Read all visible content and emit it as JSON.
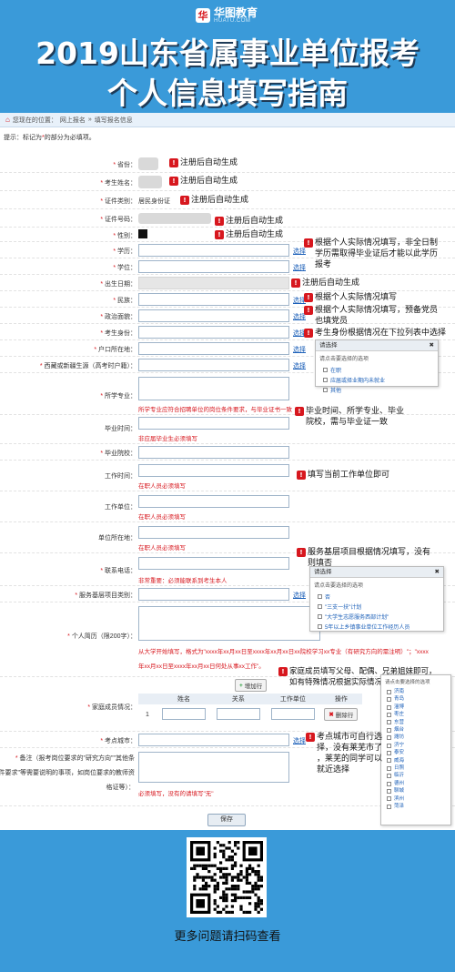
{
  "header": {
    "logo_text": "华图教育",
    "logo_sub": "HUATU.COM",
    "title_line1": "2019山东省属事业单位报考",
    "title_line2": "个人信息填写指南"
  },
  "breadcrumb": {
    "prefix": "您现在的位置：",
    "item1": "网上报名",
    "item2": "填写报名信息"
  },
  "note": {
    "text": "提示：标记为",
    "star": "*",
    "text2": "的部分为必填项。"
  },
  "fields": {
    "province": "省份：",
    "name": "考生姓名：",
    "id_type": "证件类别：",
    "id_type_value": "居民身份证",
    "id_no": "证件号码：",
    "gender": "性别：",
    "edu": "学历：",
    "degree": "学位：",
    "birth": "出生日期：",
    "ethnic": "民族：",
    "politics": "政治面貌：",
    "identity": "考生身份：",
    "hukou": "户口所在地：",
    "origin": "西藏或新疆生源（高考时户籍）：",
    "major": "所学专业：",
    "grad_time": "毕业时间：",
    "school": "毕业院校：",
    "work_time": "工作时间：",
    "employer": "工作单位：",
    "employer_loc": "单位所在地：",
    "phone": "联系电话：",
    "grassroots": "服务基层项目类别：",
    "resume": "个人简历（限200字）：",
    "family": "家庭成员情况：",
    "exam_city": "考点城市：",
    "remark_l1": "备注（报考岗位要求的\"研究方向\"\"其他条",
    "remark_l2": "件要求\"等需要说明的事项，如岗位要求的教师资",
    "remark_l3": "格证等）："
  },
  "links": {
    "select": "选择"
  },
  "hints": {
    "major": "所学专业应符合招聘单位的岗位条件要求，与毕业证书一致",
    "grad": "非应届毕业生必须填写",
    "work_time": "在职人员必须填写",
    "employer": "在职人员必须填写",
    "employer_loc": "在职人员必须填写",
    "phone": "非常重要：必须能联系到考生本人",
    "resume_l1": "从大学开始填写，格式为\"xxxx年xx月xx日至xxxx年xx月xx日xx院校学习xx专业（有研究方向的需注明）\"；\"xxxx",
    "resume_l2": "年xx月xx日至xxxx年xx月xx日何处从事xx工作\"。",
    "remark": "必须填写，没有的请填写\"无\""
  },
  "annotations": {
    "a1": "注册后自动生成",
    "a2": "注册后自动生成",
    "a3": "注册后自动生成",
    "a4": "注册后自动生成",
    "a5": "注册后自动生成",
    "a_edu_l1": "根据个人实际情况填写，非全日制",
    "a_edu_l2": "学历需取得毕业证后才能以此学历",
    "a_edu_l3": "报考",
    "a_birth": "注册后自动生成",
    "a_ethnic": "根据个人实际情况填写",
    "a_pol_l1": "根据个人实际情况填写，预备党员",
    "a_pol_l2": "也填党员",
    "a_identity": "考生身份根据情况在下拉列表中选择",
    "a_grad_l1": "毕业时间、所学专业、毕业",
    "a_grad_l2": "院校，需与毕业证一致",
    "a_work": "填写当前工作单位即可",
    "a_grass_l1": "服务基层项目根据情况填写，没有",
    "a_grass_l2": "则填否",
    "a_fam_l1": "家庭成员填写父母、配偶、兄弟姐妹即可，",
    "a_fam_l2": "如有特殊情况根据实际情况填写",
    "a_city_l1": "考点城市可自行选",
    "a_city_l2": "择，没有莱芜市了",
    "a_city_l3": "，莱芜的同学可以",
    "a_city_l4": "就近选择"
  },
  "popup_identity": {
    "title": "请选择",
    "prompt": "请点击要选择的选项",
    "options": [
      "在职",
      "应届或择业期内未就业",
      "其他"
    ]
  },
  "popup_grassroots": {
    "title": "请选择",
    "prompt": "请点击要选择的选项",
    "options": [
      "否",
      "\"三支一扶\"计划",
      "\"大学生志愿服务西部计划\"",
      "5年以上乡镇事业单位工作经历人员"
    ]
  },
  "popup_city": {
    "prompt": "请点击要选择的选项",
    "options": [
      "济南",
      "青岛",
      "淄博",
      "枣庄",
      "东营",
      "烟台",
      "潍坊",
      "济宁",
      "泰安",
      "威海",
      "日照",
      "临沂",
      "德州",
      "聊城",
      "滨州",
      "菏泽"
    ]
  },
  "family_table": {
    "col_name": "姓名",
    "col_rel": "关系",
    "col_work": "工作单位",
    "col_op": "操作",
    "row_no": "1",
    "add_btn": "增加行",
    "del_btn": "删除行"
  },
  "save_btn": "保存",
  "qr_caption": "更多问题请扫码查看",
  "colors": {
    "background": "#3a9ad9",
    "required": "#d7171e",
    "link": "#1b5fb8"
  }
}
